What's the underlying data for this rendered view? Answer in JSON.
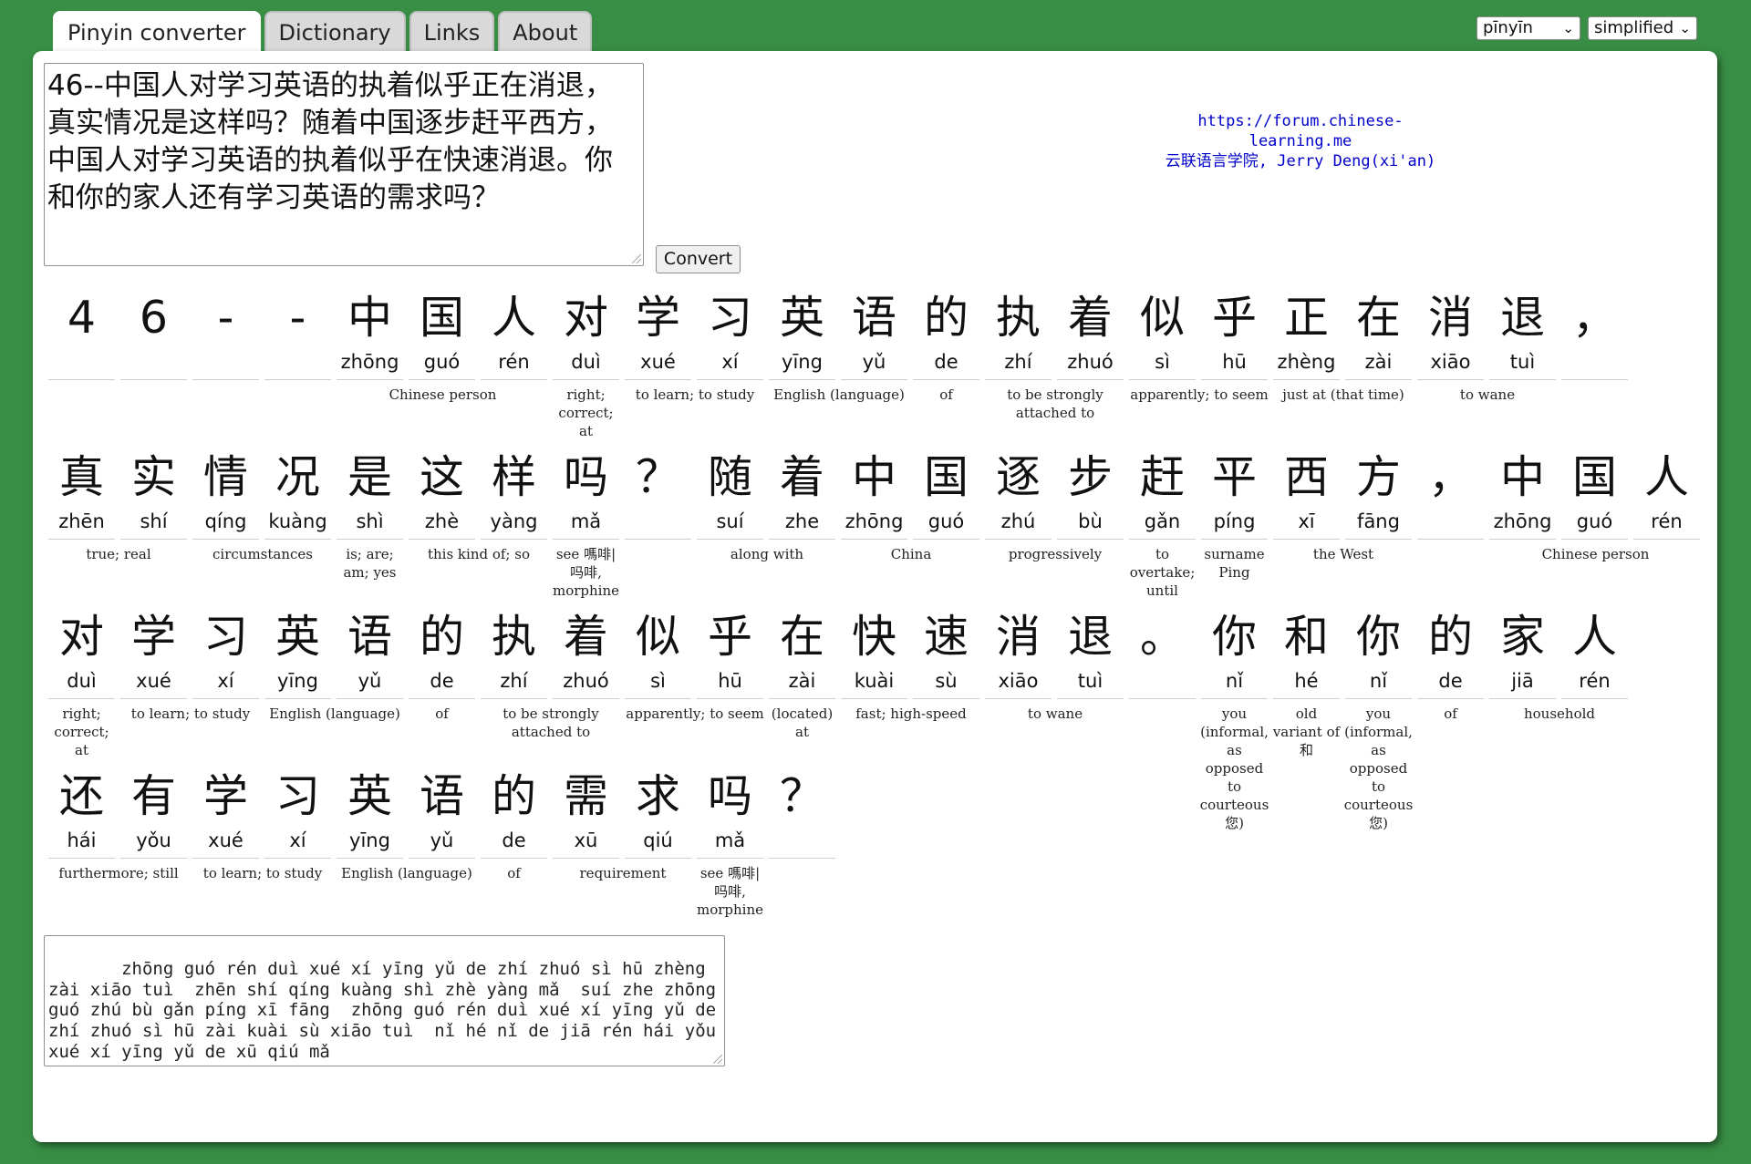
{
  "tabs": [
    {
      "label": "Pinyin converter",
      "active": true
    },
    {
      "label": "Dictionary",
      "active": false
    },
    {
      "label": "Links",
      "active": false
    },
    {
      "label": "About",
      "active": false
    }
  ],
  "selects": {
    "pinyin_mode": "pīnyīn",
    "script": "simplified"
  },
  "input_text": "46--中国人对学习英语的执着似乎正在消退，真实情况是这样吗？随着中国逐步赶平西方，中国人对学习英语的执着似乎在快速消退。你和你的家人还有学习英语的需求吗？",
  "convert_label": "Convert",
  "credit": {
    "url": "https://forum.chinese-learning.me",
    "author": "云联语言学院, Jerry Deng(xi'an)"
  },
  "rows": [
    [
      {
        "hz": "4",
        "py": ""
      },
      {
        "hz": "6",
        "py": ""
      },
      {
        "hz": "-",
        "py": ""
      },
      {
        "hz": "-",
        "py": ""
      },
      {
        "hz": "中",
        "py": "zhōng",
        "def": "Chinese person",
        "span": 3
      },
      {
        "hz": "国",
        "py": "guó"
      },
      {
        "hz": "人",
        "py": "rén"
      },
      {
        "hz": "对",
        "py": "duì",
        "def": "right; correct; at",
        "span": 1
      },
      {
        "hz": "学",
        "py": "xué",
        "def": "to learn; to study",
        "span": 2
      },
      {
        "hz": "习",
        "py": "xí"
      },
      {
        "hz": "英",
        "py": "yīng",
        "def": "English (language)",
        "span": 2
      },
      {
        "hz": "语",
        "py": "yǔ"
      },
      {
        "hz": "的",
        "py": "de",
        "def": "of",
        "span": 1
      },
      {
        "hz": "执",
        "py": "zhí",
        "def": "to be strongly attached to",
        "span": 2
      },
      {
        "hz": "着",
        "py": "zhuó"
      },
      {
        "hz": "似",
        "py": "sì",
        "def": "apparently; to seem",
        "span": 2
      },
      {
        "hz": "乎",
        "py": "hū"
      },
      {
        "hz": "正",
        "py": "zhèng",
        "def": "just at (that time)",
        "span": 2
      },
      {
        "hz": "在",
        "py": "zài"
      },
      {
        "hz": "消",
        "py": "xiāo",
        "def": "to wane",
        "span": 2
      },
      {
        "hz": "退",
        "py": "tuì"
      },
      {
        "hz": "，",
        "py": ""
      }
    ],
    [
      {
        "hz": "真",
        "py": "zhēn",
        "def": "true; real",
        "span": 2
      },
      {
        "hz": "实",
        "py": "shí"
      },
      {
        "hz": "情",
        "py": "qíng",
        "def": "circumstances",
        "span": 2
      },
      {
        "hz": "况",
        "py": "kuàng"
      },
      {
        "hz": "是",
        "py": "shì",
        "def": "is; are; am; yes",
        "span": 1
      },
      {
        "hz": "这",
        "py": "zhè",
        "def": "this kind of; so",
        "span": 2
      },
      {
        "hz": "样",
        "py": "yàng"
      },
      {
        "hz": "吗",
        "py": "mǎ",
        "def": "see 嗎啡|吗啡, morphine",
        "span": 1
      },
      {
        "hz": "？",
        "py": ""
      },
      {
        "hz": "随",
        "py": "suí",
        "def": "along with",
        "span": 2
      },
      {
        "hz": "着",
        "py": "zhe"
      },
      {
        "hz": "中",
        "py": "zhōng",
        "def": "China",
        "span": 2
      },
      {
        "hz": "国",
        "py": "guó"
      },
      {
        "hz": "逐",
        "py": "zhú",
        "def": "progressively",
        "span": 2
      },
      {
        "hz": "步",
        "py": "bù"
      },
      {
        "hz": "赶",
        "py": "gǎn",
        "def": "to overtake; until",
        "span": 1
      },
      {
        "hz": "平",
        "py": "píng",
        "def": "surname Ping",
        "span": 1
      },
      {
        "hz": "西",
        "py": "xī",
        "def": "the West",
        "span": 2
      },
      {
        "hz": "方",
        "py": "fāng"
      },
      {
        "hz": "，",
        "py": ""
      },
      {
        "hz": "中",
        "py": "zhōng",
        "def": "Chinese person",
        "span": 3
      },
      {
        "hz": "国",
        "py": "guó"
      },
      {
        "hz": "人",
        "py": "rén"
      }
    ],
    [
      {
        "hz": "对",
        "py": "duì",
        "def": "right; correct; at",
        "span": 1
      },
      {
        "hz": "学",
        "py": "xué",
        "def": "to learn; to study",
        "span": 2
      },
      {
        "hz": "习",
        "py": "xí"
      },
      {
        "hz": "英",
        "py": "yīng",
        "def": "English (language)",
        "span": 2
      },
      {
        "hz": "语",
        "py": "yǔ"
      },
      {
        "hz": "的",
        "py": "de",
        "def": "of",
        "span": 1
      },
      {
        "hz": "执",
        "py": "zhí",
        "def": "to be strongly attached to",
        "span": 2
      },
      {
        "hz": "着",
        "py": "zhuó"
      },
      {
        "hz": "似",
        "py": "sì",
        "def": "apparently; to seem",
        "span": 2
      },
      {
        "hz": "乎",
        "py": "hū"
      },
      {
        "hz": "在",
        "py": "zài",
        "def": "(located) at",
        "span": 1
      },
      {
        "hz": "快",
        "py": "kuài",
        "def": "fast; high-speed",
        "span": 2
      },
      {
        "hz": "速",
        "py": "sù"
      },
      {
        "hz": "消",
        "py": "xiāo",
        "def": "to wane",
        "span": 2
      },
      {
        "hz": "退",
        "py": "tuì"
      },
      {
        "hz": "。",
        "py": ""
      },
      {
        "hz": "你",
        "py": "nǐ",
        "def": "you (informal, as opposed to courteous 您)",
        "span": 1
      },
      {
        "hz": "和",
        "py": "hé",
        "def": "old variant of 和",
        "span": 1
      },
      {
        "hz": "你",
        "py": "nǐ",
        "def": "you (informal, as opposed to courteous 您)",
        "span": 1
      },
      {
        "hz": "的",
        "py": "de",
        "def": "of",
        "span": 1
      },
      {
        "hz": "家",
        "py": "jiā",
        "def": "household",
        "span": 2
      },
      {
        "hz": "人",
        "py": "rén"
      }
    ],
    [
      {
        "hz": "还",
        "py": "hái",
        "def": "furthermore; still",
        "span": 2
      },
      {
        "hz": "有",
        "py": "yǒu"
      },
      {
        "hz": "学",
        "py": "xué",
        "def": "to learn; to study",
        "span": 2
      },
      {
        "hz": "习",
        "py": "xí"
      },
      {
        "hz": "英",
        "py": "yīng",
        "def": "English (language)",
        "span": 2
      },
      {
        "hz": "语",
        "py": "yǔ"
      },
      {
        "hz": "的",
        "py": "de",
        "def": "of",
        "span": 1
      },
      {
        "hz": "需",
        "py": "xū",
        "def": "requirement",
        "span": 2
      },
      {
        "hz": "求",
        "py": "qiú"
      },
      {
        "hz": "吗",
        "py": "mǎ",
        "def": "see 嗎啡|吗啡, morphine",
        "span": 1
      },
      {
        "hz": "？",
        "py": ""
      }
    ]
  ],
  "output_text": "   zhōng guó rén duì xué xí yīng yǔ de zhí zhuó sì hū zhèng zài xiāo tuì  zhēn shí qíng kuàng shì zhè yàng mǎ  suí zhe zhōng guó zhú bù gǎn píng xī fāng  zhōng guó rén duì xué xí yīng yǔ de zhí zhuó sì hū zài kuài sù xiāo tuì  nǐ hé nǐ de jiā rén hái yǒu xué xí yīng yǔ de xū qiú mǎ"
}
